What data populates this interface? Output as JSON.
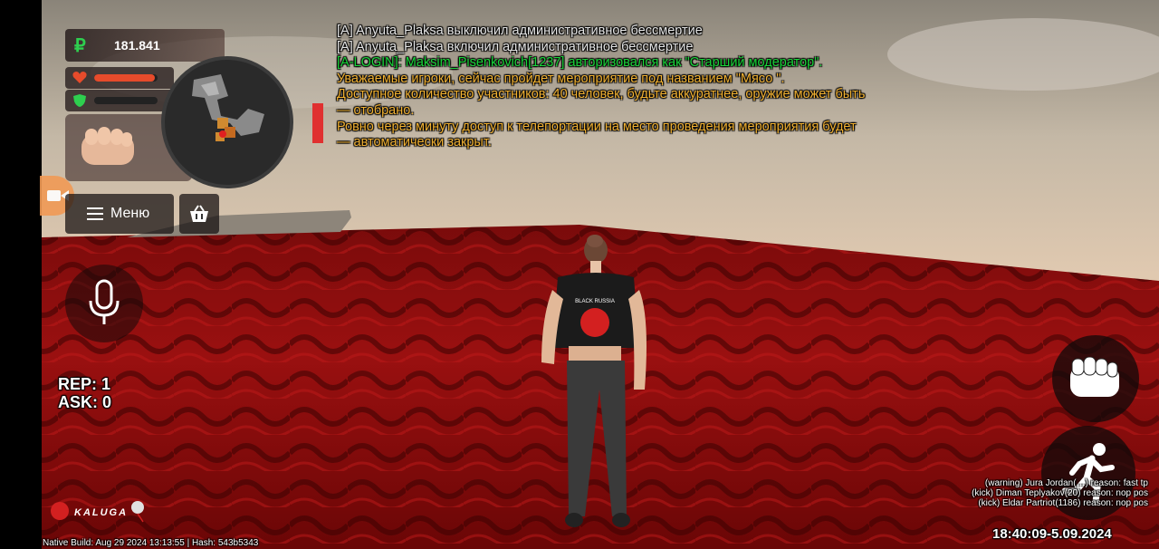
{
  "hud": {
    "money": {
      "symbol": "₽",
      "amount": "181.841"
    },
    "health_level": 0.95,
    "armor_level": 0.0,
    "menu_label": "Меню",
    "stats": {
      "rep": "REP: 1",
      "ask": "ASK: 0"
    },
    "clock": "18:40:09-5.09.2024",
    "server_logo": "KALUGA",
    "build_info": "Native Build: Aug 29 2024 13:13:55 | Hash: 543b5343"
  },
  "chat": {
    "lines": [
      {
        "text": "[A] Anyuta_Plaksa выключил административное бессмертие",
        "color": "#e6e6e6"
      },
      {
        "text": "[A] Anyuta_Plaksa включил административное бессмертие",
        "color": "#e6e6e6"
      },
      {
        "text": "[A-LOGIN]: Maksim_Pisenkovich[1237] авторизовался как \"Старший модератор\".",
        "color": "#19d63a"
      },
      {
        "text": "Уважаемые игроки, сейчас пройдет мероприятие под названием \"Мясо \".",
        "color": "#f2b233"
      },
      {
        "text": "Доступное количество участников: 40 человек, будьте аккуратнее, оружие может быть",
        "color": "#f2b233"
      },
      {
        "text": "—  отобрано.",
        "color": "#f2b233"
      },
      {
        "text": "Ровно через минуту доступ к телепортации на место проведения мероприятия будет",
        "color": "#f2b233"
      },
      {
        "text": "—  автоматически закрыт.",
        "color": "#f2b233"
      }
    ]
  },
  "kill_feed": [
    "(warning) Jura Jordan(…) reason: fast tp",
    "(kick) Diman Teplyakov(20) reason: nop pos",
    "(kick) Eldar Partriot(1186) reason: nop pos"
  ],
  "character": {
    "shirt_text": "BLACK RUSSIA"
  },
  "colors": {
    "ground": "#8c0d0d",
    "health": "#e74b2b",
    "armor": "#2ecf4f",
    "money_symbol": "#2ecf4f",
    "alert": "#e03030",
    "record": "#f19a55"
  }
}
